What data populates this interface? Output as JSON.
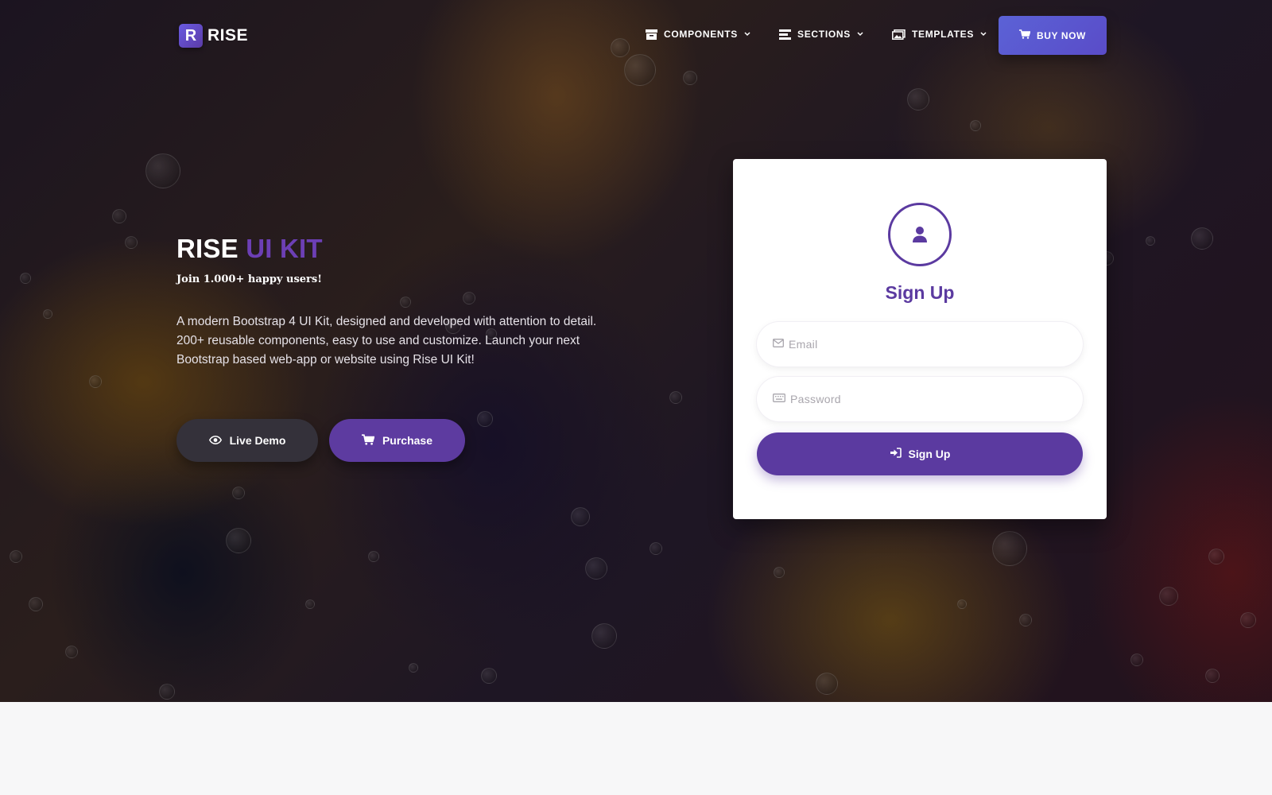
{
  "brand": {
    "mark": "R",
    "name": "RISE"
  },
  "nav": {
    "items": [
      {
        "label": "COMPONENTS",
        "icon": "archive-icon"
      },
      {
        "label": "SECTIONS",
        "icon": "list-icon"
      },
      {
        "label": "TEMPLATES",
        "icon": "images-icon"
      }
    ],
    "buy_label": "BUY NOW"
  },
  "hero": {
    "title_main": "RISE",
    "title_accent": "UI KIT",
    "subtitle": "Join 1.000+ happy users!",
    "description": "A modern Bootstrap 4 UI Kit, designed and developed with attention to detail. 200+ reusable components, easy to use and customize. Launch your next Bootstrap based web-app or website using Rise UI Kit!",
    "live_demo_label": "Live Demo",
    "purchase_label": "Purchase"
  },
  "signup": {
    "title": "Sign Up",
    "email_placeholder": "Email",
    "password_placeholder": "Password",
    "submit_label": "Sign Up"
  },
  "colors": {
    "accent": "#5b3aa0",
    "buy_button": "#5a52cf",
    "demo_button": "#34313a"
  }
}
